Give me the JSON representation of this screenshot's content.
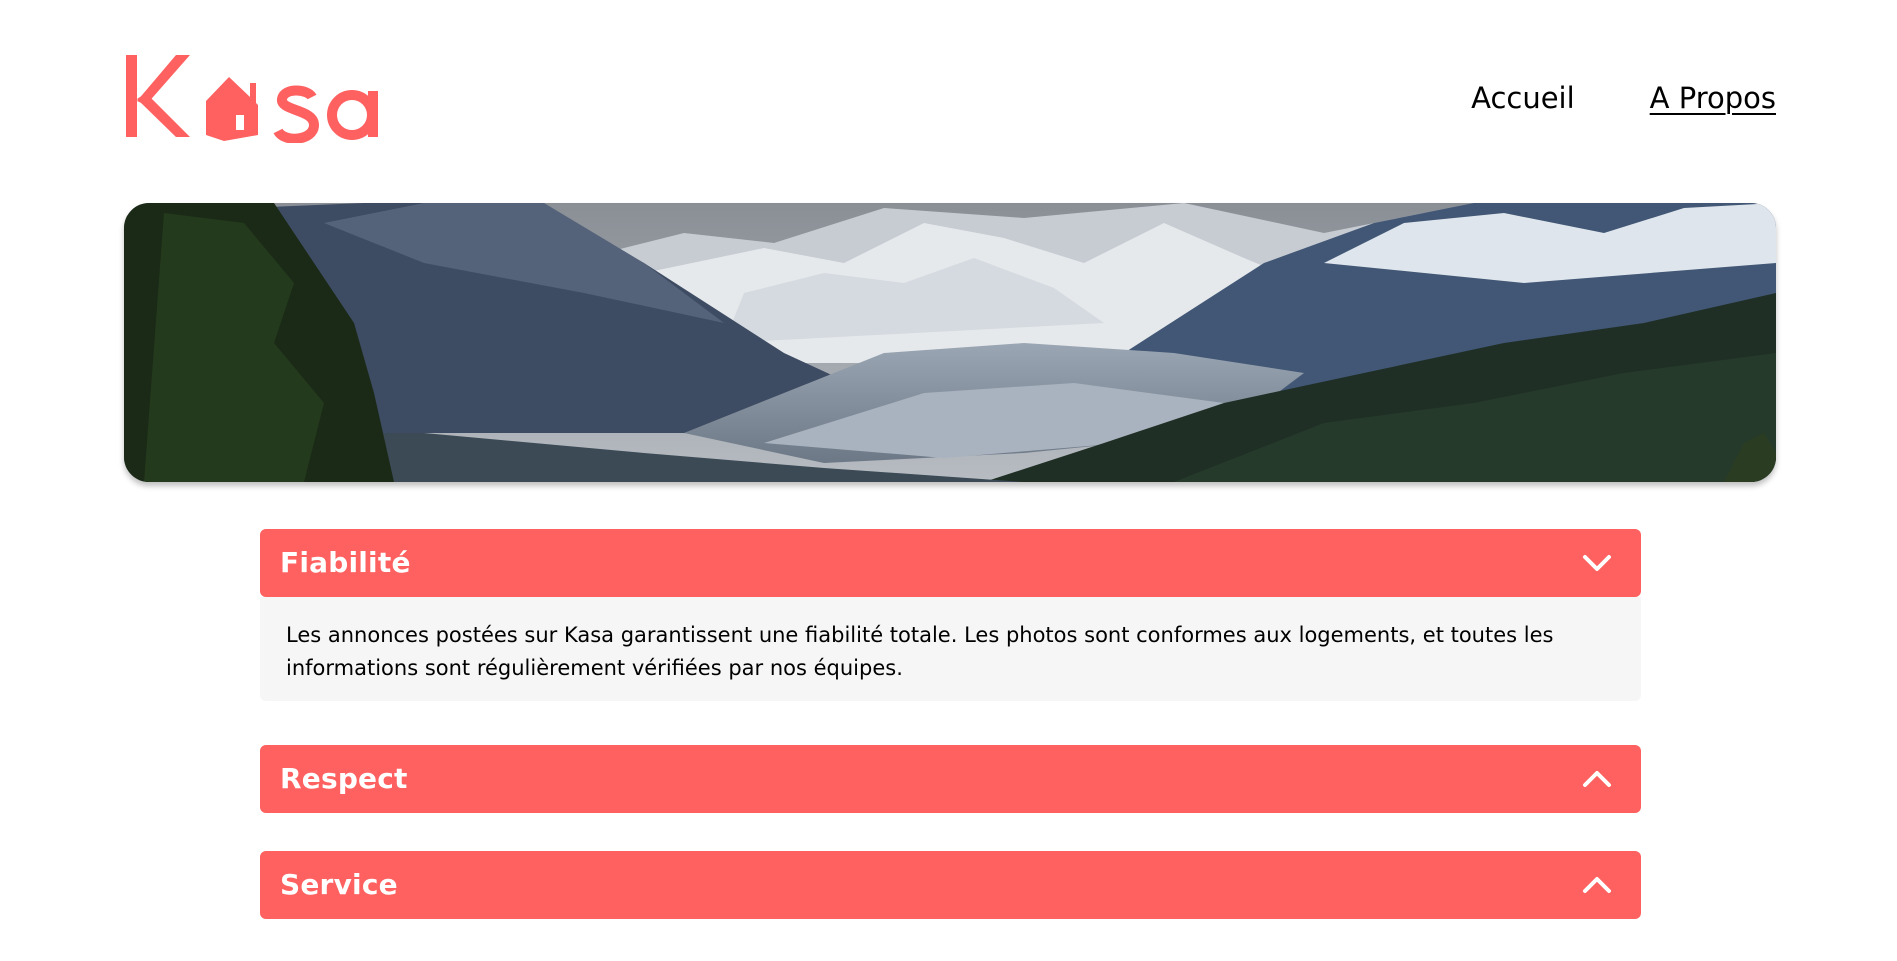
{
  "brand": {
    "logo_text": "Kasa",
    "accent_color": "#FF6060"
  },
  "nav": {
    "home_label": "Accueil",
    "about_label": "A Propos",
    "active": "A Propos"
  },
  "banner": {
    "image": "mountain-valley-landscape"
  },
  "collapses": [
    {
      "title": "Fiabilité",
      "expanded": true,
      "icon": "chevron-down-icon",
      "content": "Les annonces postées sur Kasa garantissent une fiabilité totale. Les photos sont conformes aux logements, et toutes les informations sont régulièrement vérifiées par nos équipes."
    },
    {
      "title": "Respect",
      "expanded": false,
      "icon": "chevron-up-icon"
    },
    {
      "title": "Service",
      "expanded": false,
      "icon": "chevron-up-icon"
    }
  ]
}
